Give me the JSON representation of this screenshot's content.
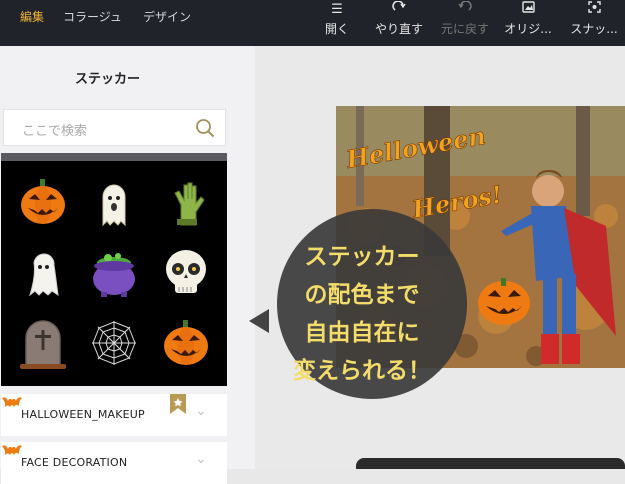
{
  "menu_tabs": [
    {
      "label": "編集",
      "active": true
    },
    {
      "label": "コラージュ",
      "active": false
    },
    {
      "label": "デザイン",
      "active": false
    }
  ],
  "toolbar": {
    "open": {
      "label": "開く",
      "icon": "menu-icon"
    },
    "redo": {
      "label": "やり直す",
      "icon": "redo-icon"
    },
    "undo": {
      "label": "元に戻す",
      "icon": "undo-icon",
      "disabled": true
    },
    "original": {
      "label": "オリジ...",
      "icon": "image-icon"
    },
    "snapshot": {
      "label": "スナッ...",
      "icon": "snapshot-icon"
    }
  },
  "sidebar": {
    "title": "ステッカー",
    "search_placeholder": "ここで検索",
    "stickers": [
      "jack-o-lantern",
      "ghost",
      "zombie-hand",
      "ghost",
      "cauldron",
      "skull",
      "tombstone",
      "spider-web",
      "jack-o-lantern"
    ],
    "categories": [
      {
        "label": "HALLOWEEN_MAKEUP"
      },
      {
        "label": "FACE DECORATION"
      }
    ]
  },
  "photo": {
    "caption_line1": "Helloween",
    "caption_line2": "Heros!"
  },
  "callout": {
    "lines": [
      "ステッカー",
      "の配色まで",
      "自由自在に",
      "変えられる！"
    ]
  },
  "colors": {
    "accent": "#f2b43a",
    "topbar": "#20232a",
    "callout_bg": "#3a3a3a",
    "callout_text": "#f4dc6a"
  }
}
